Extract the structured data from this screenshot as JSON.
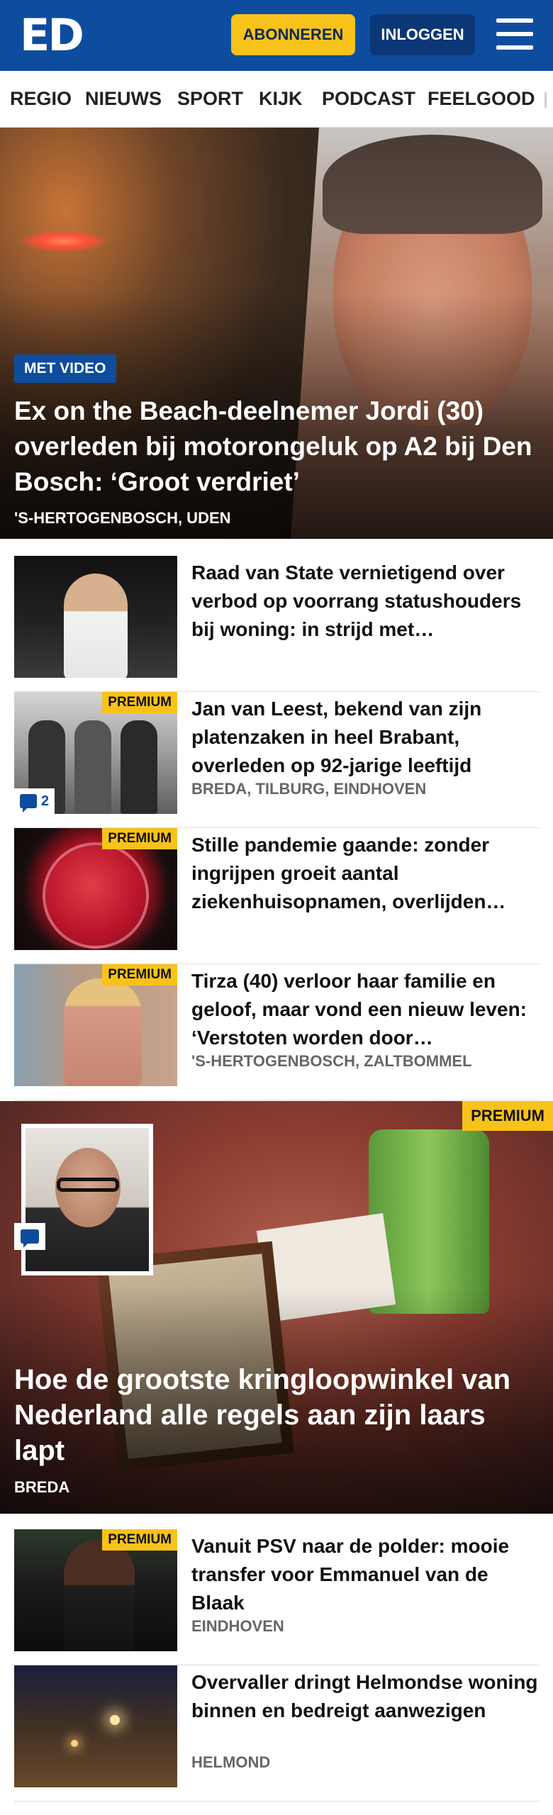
{
  "header": {
    "logo": "ED",
    "subscribe_label": "ABONNEREN",
    "login_label": "INLOGGEN"
  },
  "nav": {
    "items": [
      "REGIO",
      "NIEUWS",
      "SPORT",
      "KIJK",
      "PODCAST",
      "FEELGOOD"
    ]
  },
  "hero": {
    "badge": "MET VIDEO",
    "title": "Ex on the Beach-deelnemer Jordi (30) overleden bij motorongeluk op A2 bij Den Bosch: ‘Groot verdriet’",
    "location": "'S-HERTOGENBOSCH, UDEN"
  },
  "articles": [
    {
      "title": "Raad van State vernietigend over verbod op voorrang statushou­ders bij woning: in strijd met…",
      "location": "",
      "premium": ""
    },
    {
      "title": "Jan van Leest, bekend van zijn platenzaken in heel Brabant, overleden op 92-jarige leeftijd",
      "location": "BREDA, TILBURG, EINDHOVEN",
      "premium": "PREMIUM",
      "comments": "2"
    },
    {
      "title": "Stille pandemie gaande: zonder ingrijpen groeit aantal ziekenhuisopnamen, overlijden…",
      "location": "",
      "premium": "PREMIUM"
    },
    {
      "title": "Tirza (40) verloor haar familie en geloof, maar vond een nieuw leven: ‘Verstoten worden door…",
      "location": "'S-HERTOGENBOSCH, ZALTBOMMEL",
      "premium": "PREMIUM"
    }
  ],
  "feature": {
    "premium": "PREMIUM",
    "title": "Hoe de grootste kringloopwinkel van Nederland alle regels aan zijn laars lapt",
    "location": "BREDA"
  },
  "articles2": [
    {
      "title": "Vanuit PSV naar de polder: mooie transfer voor Emmanuel van de Blaak",
      "location": "EINDHOVEN",
      "premium": "PREMIUM"
    },
    {
      "title": "Overvaller dringt Helmondse woning binnen en bedreigt aanwezigen",
      "location": "HELMOND",
      "premium": ""
    }
  ],
  "colors": {
    "brand_blue": "#0e4d9e",
    "subscribe_yellow": "#f7c21a",
    "premium_yellow": "#f7c21a"
  },
  "icons": [
    "menu-icon",
    "comment-icon"
  ]
}
